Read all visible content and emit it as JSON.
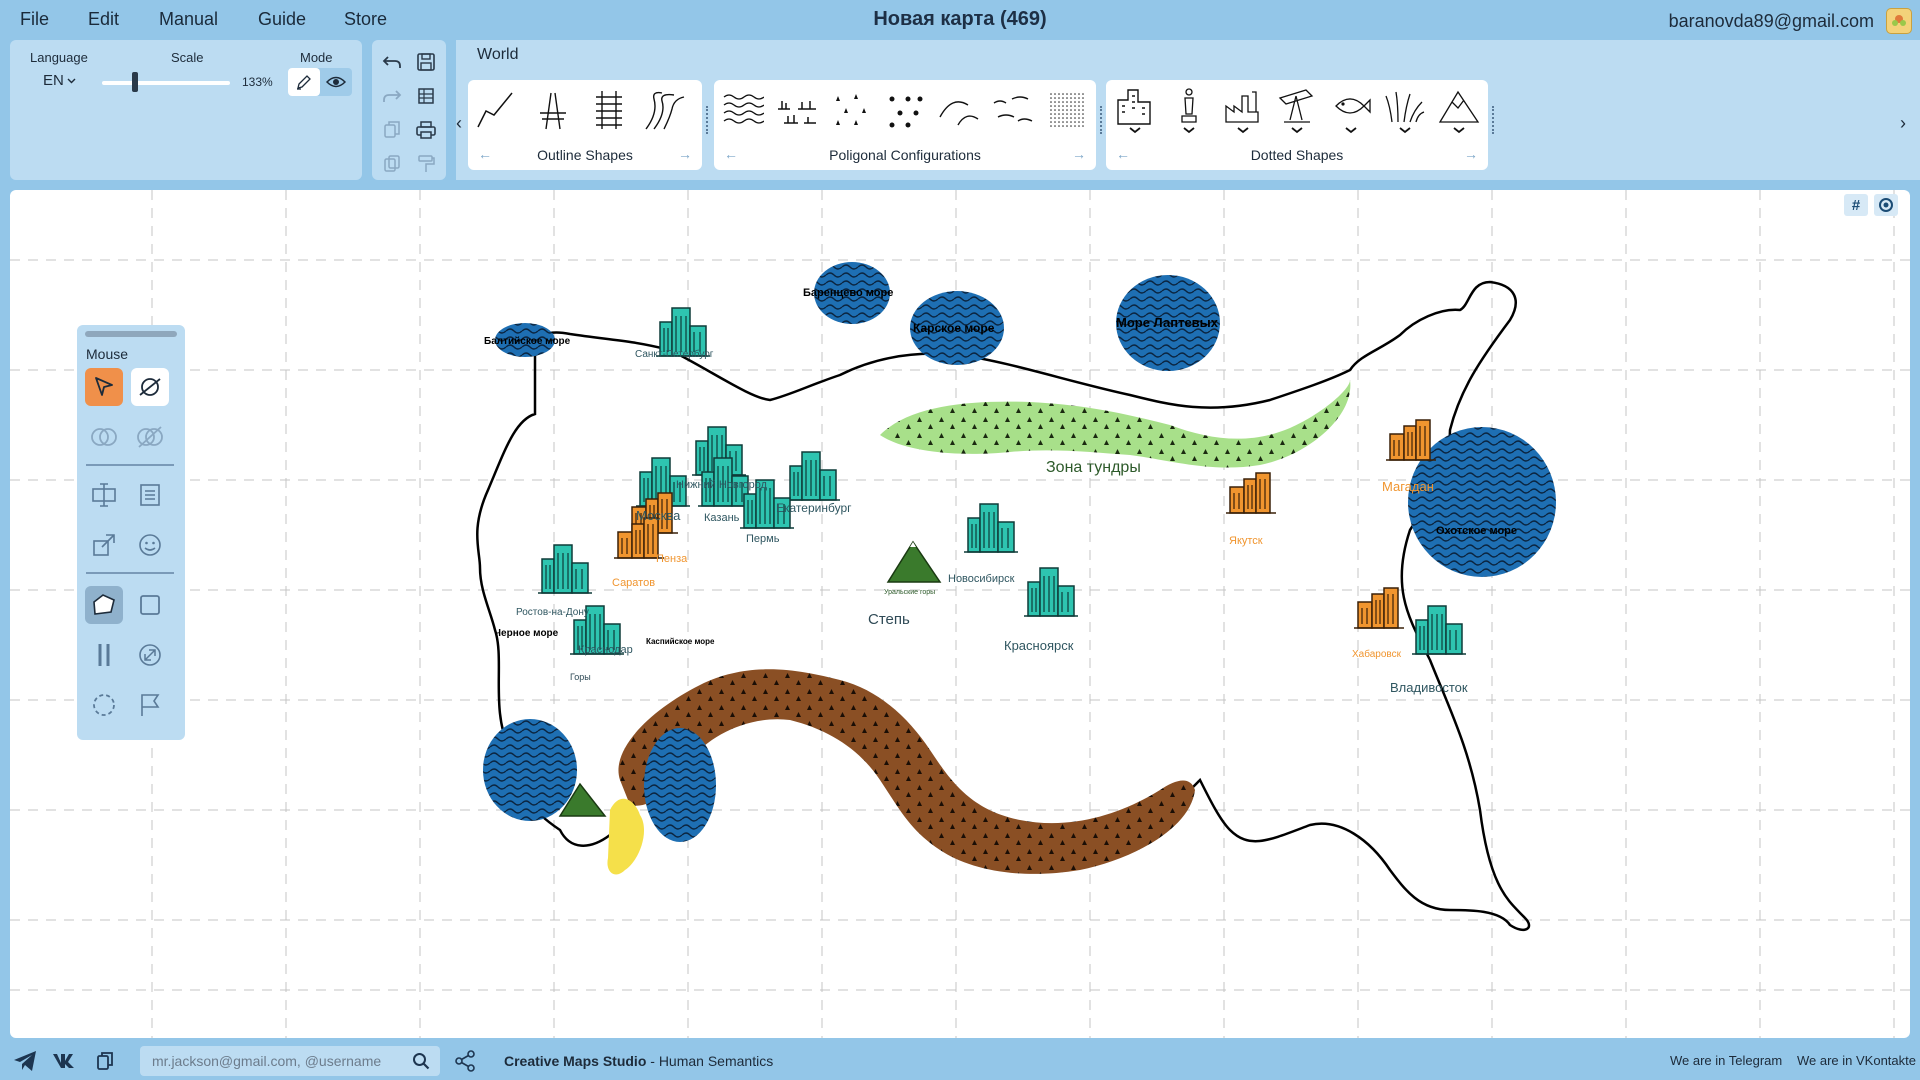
{
  "menu": {
    "items": [
      "File",
      "Edit",
      "Manual",
      "Guide",
      "Store"
    ]
  },
  "document": {
    "title": "Новая карта (469)"
  },
  "account": {
    "email": "baranovda89@gmail.com",
    "avatar_icon": "avatar-icon"
  },
  "settings": {
    "language_label": "Language",
    "language_value": "EN",
    "scale_label": "Scale",
    "scale_value": "133%",
    "mode_label": "Mode"
  },
  "toolbar": {
    "tab_label": "World",
    "groups": [
      {
        "caption": "Outline Shapes"
      },
      {
        "caption": "Poligonal Configurations"
      },
      {
        "caption": "Dotted Shapes"
      }
    ]
  },
  "palette": {
    "title": "Mouse"
  },
  "map": {
    "labels": {
      "baltic": "Балтийское море",
      "spb": "Санкт-Петербург",
      "barents": "Баренцево море",
      "kara": "Карское море",
      "laptev": "Море Лаптевых",
      "tundra": "Зона тундры",
      "nizhny": "Нижний Новгород",
      "moscow": "Москва",
      "kazan": "Казань",
      "ekb": "Екатеринбург",
      "perm": "Пермь",
      "ural": "Уральские горы",
      "magadan": "Магадан",
      "yakutsk": "Якутск",
      "okhotsk": "Охотское море",
      "penza": "Пенза",
      "saratov": "Саратов",
      "novosibirsk": "Новосибирск",
      "rostov": "Ростов-на-Дону",
      "steppe": "Степь",
      "krasnoyarsk": "Красноярск",
      "black_sea": "Черное море",
      "krasnodar": "Краснодар",
      "caspian": "Каспийское море",
      "mountains": "Горы",
      "khabarovsk": "Хабаровск",
      "vladivostok": "Владивосток"
    }
  },
  "statusbar": {
    "share_placeholder": "mr.jackson@gmail.com, @username",
    "brand_name": "Creative Maps Studio",
    "brand_suffix": " - Human Semantics",
    "telegram_link": "We are in Telegram",
    "vk_link": "We are in VKontakte"
  },
  "colors": {
    "background": "#93c6e8",
    "panel": "#bcdcf2",
    "sea": "#1e6fb3",
    "city_teal": "#2ec4b0",
    "city_orange": "#f0952f",
    "tundra": "#a8e08a",
    "steppe": "#8a4f24",
    "mountain": "#3a7a2c",
    "active_tool": "#f0904a"
  }
}
